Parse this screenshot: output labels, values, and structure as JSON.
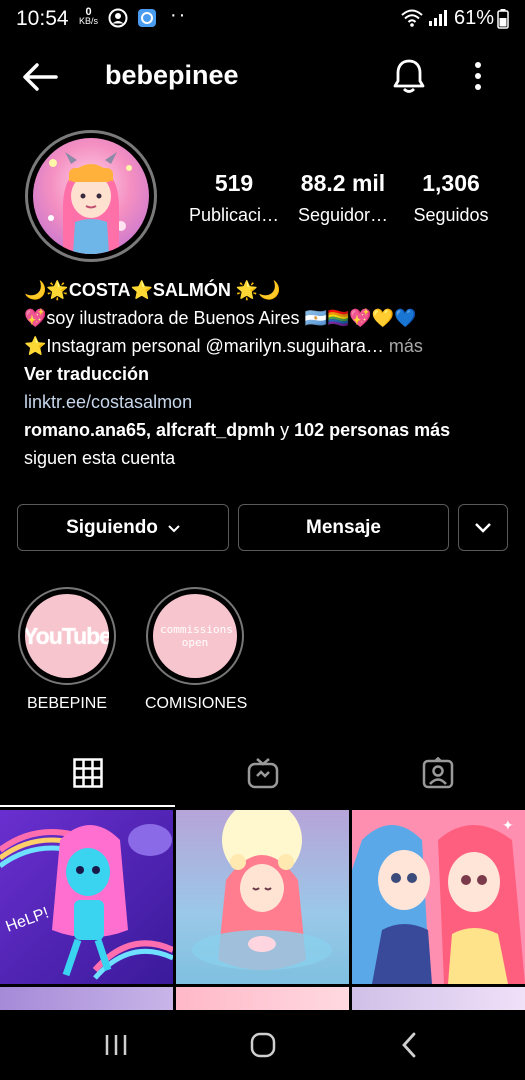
{
  "status_bar": {
    "time": "10:54",
    "net_speed_value": "0",
    "net_speed_unit": "KB/s",
    "dots": "··",
    "battery": "61%"
  },
  "header": {
    "username": "bebepinee",
    "icons": {
      "back": "arrow-left-icon",
      "bell": "bell-icon",
      "more": "kebab-icon"
    }
  },
  "stats": [
    {
      "value": "519",
      "label": "Publicaci…"
    },
    {
      "value": "88.2 mil",
      "label": "Seguidor…"
    },
    {
      "value": "1,306",
      "label": "Seguidos"
    }
  ],
  "bio": {
    "name": "🌙🌟COSTA⭐SALMÓN 🌟🌙",
    "line1": "💖soy ilustradora de Buenos Aires 🇦🇷🏳️‍🌈💖💛💙",
    "line2": "⭐Instagram personal @marilyn.suguihara…",
    "more": " más",
    "translate": "Ver traducción",
    "link": "linktr.ee/costasalmon",
    "followed_by_1": "romano.ana65, alfcraft_dpmh",
    "followed_by_and": " y ",
    "followed_by_2": "102 personas más",
    "followed_by_tail": "siguen esta cuenta"
  },
  "buttons": {
    "following": "Siguiendo",
    "message": "Mensaje"
  },
  "highlights": [
    {
      "name": "BEBEPINE",
      "cover_text": "YouTube"
    },
    {
      "name": "COMISIONES",
      "cover_text": "commissions open"
    }
  ],
  "tabs": [
    "grid-icon",
    "igtv-icon",
    "tagged-icon"
  ],
  "colors": {
    "background": "#000000",
    "link": "#c7d6ea",
    "highlight_cover": "#f7c5cd"
  }
}
